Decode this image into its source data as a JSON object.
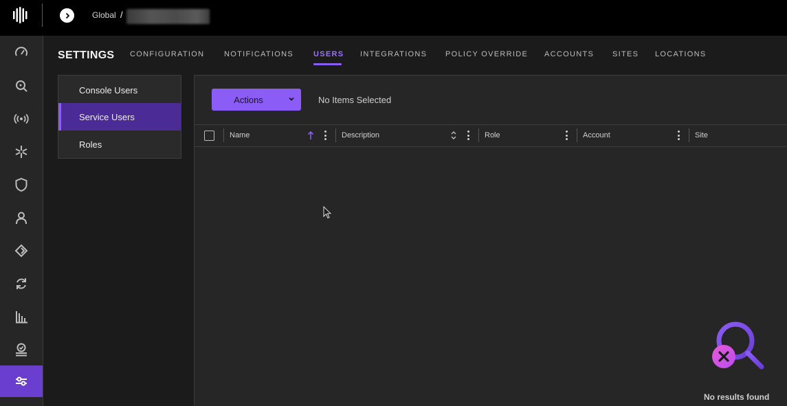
{
  "breadcrumb": {
    "root": "Global",
    "separator": "/"
  },
  "page": {
    "title": "SETTINGS"
  },
  "tabs": [
    {
      "label": "CONFIGURATION",
      "active": false
    },
    {
      "label": "NOTIFICATIONS",
      "active": false
    },
    {
      "label": "USERS",
      "active": true
    },
    {
      "label": "INTEGRATIONS",
      "active": false
    },
    {
      "label": "POLICY OVERRIDE",
      "active": false
    },
    {
      "label": "ACCOUNTS",
      "active": false
    },
    {
      "label": "SITES",
      "active": false
    },
    {
      "label": "LOCATIONS",
      "active": false
    }
  ],
  "submenu": [
    {
      "label": "Console Users",
      "active": false
    },
    {
      "label": "Service Users",
      "active": true
    },
    {
      "label": "Roles",
      "active": false
    }
  ],
  "toolbar": {
    "actions_label": "Actions",
    "selection_status": "No Items Selected"
  },
  "table": {
    "columns": [
      "Name",
      "Description",
      "Role",
      "Account",
      "Site"
    ],
    "sort": {
      "column": "Name",
      "direction": "ascending"
    },
    "rows": []
  },
  "empty_state": {
    "message": "No results found"
  },
  "leftnav": {
    "icons": [
      "dashboard-gauge-icon",
      "search-icon",
      "broadcast-icon",
      "sparkle-icon",
      "shield-icon",
      "user-icon",
      "network-diamond-icon",
      "sync-arrows-icon",
      "bar-chart-icon",
      "badge-check-icon",
      "settings-sliders-icon"
    ],
    "active": "settings-sliders-icon"
  },
  "colors": {
    "accent": "#8b5cf6",
    "active_nav": "#6a3fd0",
    "background": "#1b1b1c"
  }
}
